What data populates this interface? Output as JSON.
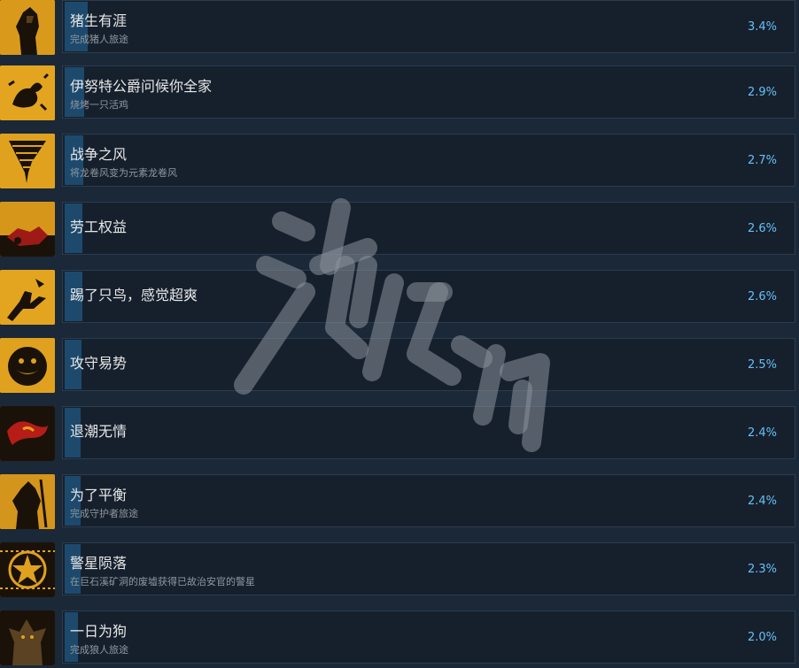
{
  "achievements": [
    {
      "title": "猪生有涯",
      "desc": "完成猪人旅途",
      "percent": "3.4%",
      "rate": 3.4,
      "icon": "boar-warrior-icon"
    },
    {
      "title": "伊努特公爵问候你全家",
      "desc": "烧烤一只活鸡",
      "percent": "2.9%",
      "rate": 2.9,
      "icon": "burning-chicken-icon"
    },
    {
      "title": "战争之风",
      "desc": "将龙卷风变为元素龙卷风",
      "percent": "2.7%",
      "rate": 2.7,
      "icon": "tornado-icon"
    },
    {
      "title": "劳工权益",
      "desc": "",
      "percent": "2.6%",
      "rate": 2.6,
      "icon": "broken-machine-icon"
    },
    {
      "title": "踢了只鸟，感觉超爽",
      "desc": "",
      "percent": "2.6%",
      "rate": 2.6,
      "icon": "kick-bird-icon"
    },
    {
      "title": "攻守易势",
      "desc": "",
      "percent": "2.5%",
      "rate": 2.5,
      "icon": "beast-head-icon"
    },
    {
      "title": "退潮无情",
      "desc": "",
      "percent": "2.4%",
      "rate": 2.4,
      "icon": "red-wave-icon"
    },
    {
      "title": "为了平衡",
      "desc": "完成守护者旅途",
      "percent": "2.4%",
      "rate": 2.4,
      "icon": "guardian-warrior-icon"
    },
    {
      "title": "警星陨落",
      "desc": "在巨石溪矿洞的废墟获得已故治安官的警星",
      "percent": "2.3%",
      "rate": 2.3,
      "icon": "sheriff-star-icon"
    },
    {
      "title": "一日为狗",
      "desc": "完成狼人旅途",
      "percent": "2.0%",
      "rate": 2.0,
      "icon": "wolf-warrior-icon"
    }
  ],
  "watermark": "游侠网",
  "colors": {
    "background": "#1b2838",
    "panel": "#16202d",
    "progress": "#1d4a6c",
    "percent_text": "#66c0f4",
    "icon_gold": "#e0a420"
  }
}
